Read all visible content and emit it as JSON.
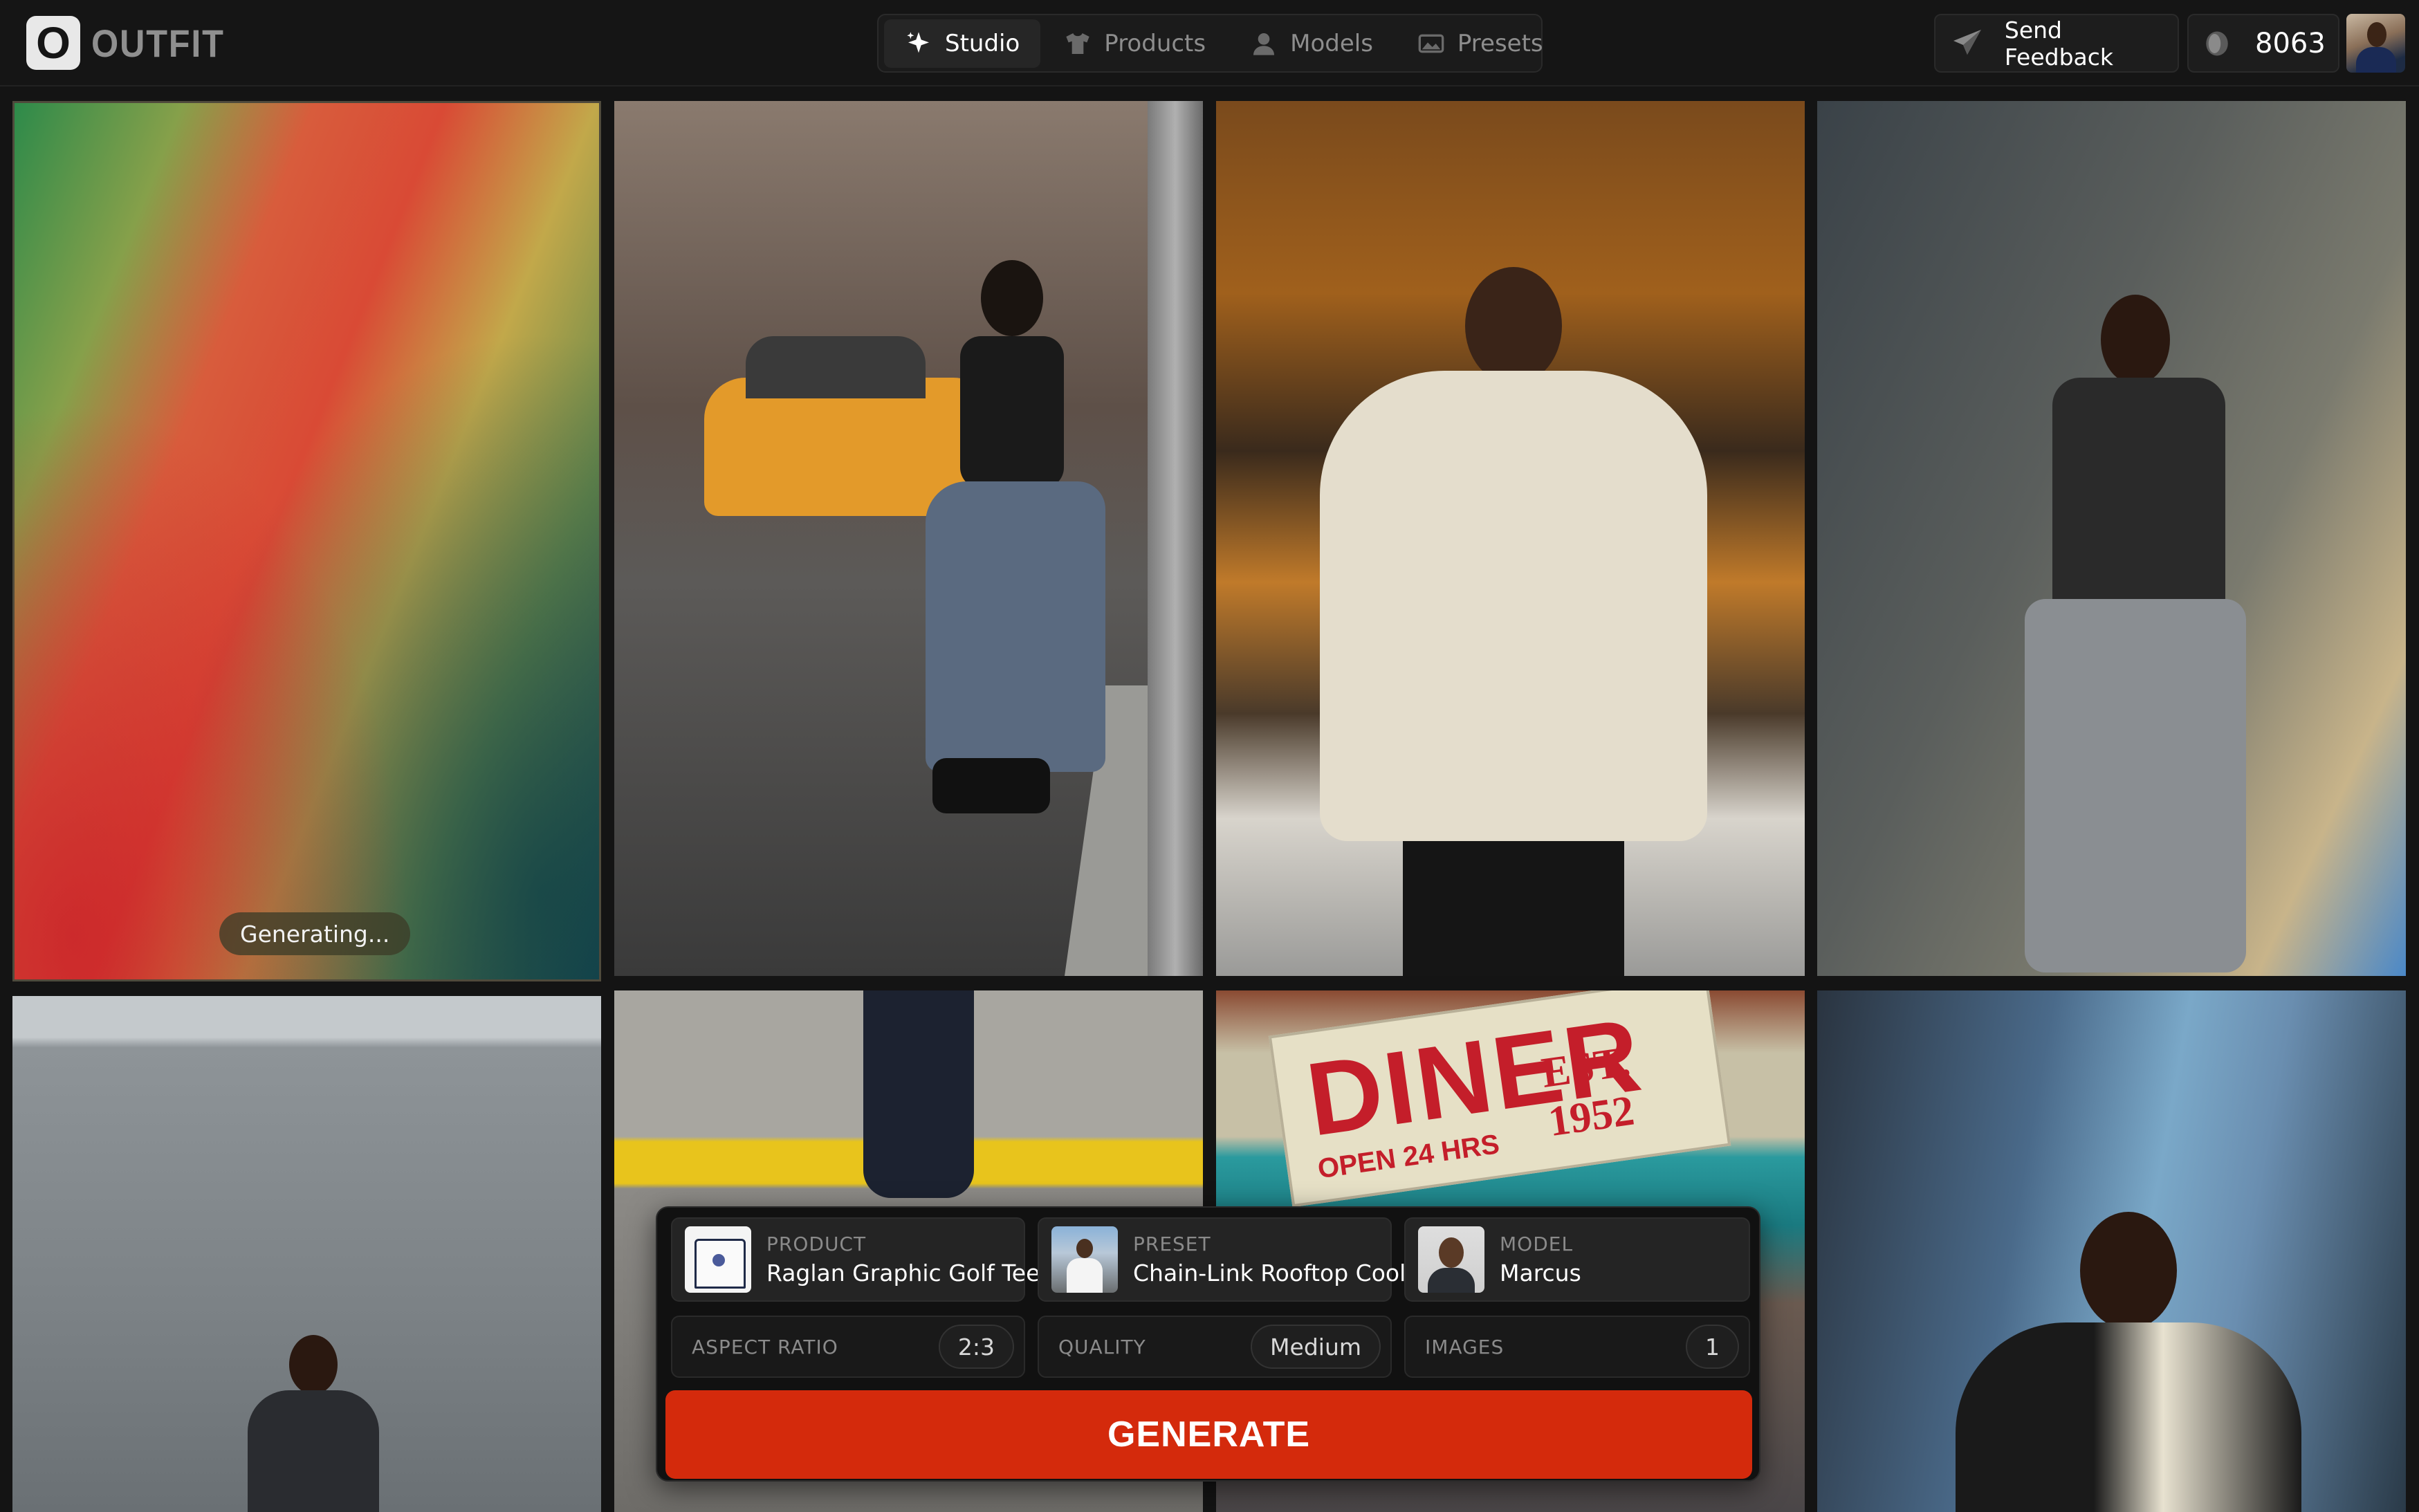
{
  "app": {
    "logo_mark": "O",
    "logo_text": "OUTFIT"
  },
  "nav": {
    "tabs": [
      {
        "label": "Studio",
        "icon": "sparkle-icon",
        "active": true
      },
      {
        "label": "Products",
        "icon": "shirt-icon",
        "active": false
      },
      {
        "label": "Models",
        "icon": "person-icon",
        "active": false
      },
      {
        "label": "Presets",
        "icon": "image-icon",
        "active": false
      }
    ]
  },
  "header_actions": {
    "feedback_label": "Send Feedback",
    "credits": "8063"
  },
  "grid": {
    "generating_label": "Generating...",
    "tiles": [
      {
        "id": 1,
        "icon": "gradient-placeholder",
        "status": "generating"
      },
      {
        "id": 2,
        "icon": "photo-woman-street-taxi"
      },
      {
        "id": 3,
        "icon": "photo-man-hoodie-kitchen"
      },
      {
        "id": 4,
        "icon": "photo-man-concrete-wall"
      },
      {
        "id": 5,
        "icon": "photo-man-concrete-wall-wide"
      },
      {
        "id": 6,
        "icon": "photo-legs-yellow-line"
      },
      {
        "id": 7,
        "icon": "photo-diner-sign"
      },
      {
        "id": 8,
        "icon": "photo-man-track-jacket"
      }
    ],
    "diner_sign": {
      "big": "DINER",
      "small": "OPEN 24 HRS",
      "est": "EST. 1952"
    }
  },
  "generator": {
    "product": {
      "label": "PRODUCT",
      "value": "Raglan Graphic Golf Tee"
    },
    "preset": {
      "label": "PRESET",
      "value": "Chain-Link Rooftop Cool"
    },
    "model": {
      "label": "MODEL",
      "value": "Marcus"
    },
    "aspect_ratio": {
      "label": "ASPECT RATIO",
      "value": "2:3"
    },
    "quality": {
      "label": "QUALITY",
      "value": "Medium"
    },
    "images": {
      "label": "IMAGES",
      "value": "1"
    },
    "generate_label": "GENERATE"
  },
  "colors": {
    "accent": "#d42a0c",
    "background": "#141414"
  }
}
